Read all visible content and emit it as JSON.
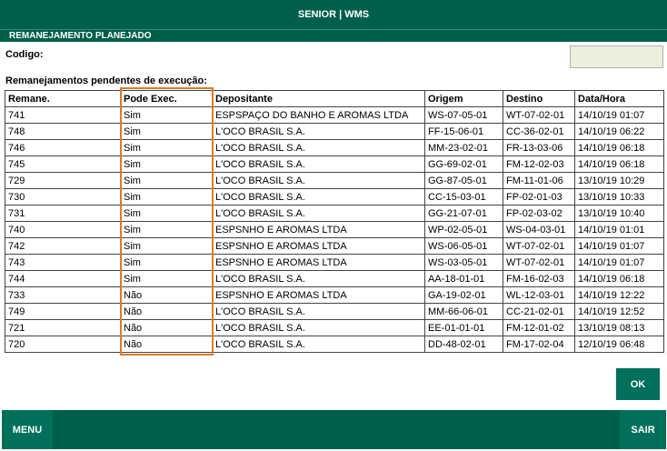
{
  "header": {
    "title": "SENIOR | WMS",
    "subtitle": "REMANEJAMENTO PLANEJADO"
  },
  "form": {
    "code_label": "Codigo:",
    "code_value": ""
  },
  "section_label": "Remanejamentos pendentes de execução:",
  "table": {
    "columns": [
      "Remane.",
      "Pode Exec.",
      "Depositante",
      "Origem",
      "Destino",
      "Data/Hora"
    ],
    "rows": [
      [
        "741",
        "Sim",
        "ESPSPAÇO DO BANHO E AROMAS LTDA",
        "WS-07-05-01",
        "WT-07-02-01",
        "14/10/19 01:07"
      ],
      [
        "748",
        "Sim",
        "L'OCO BRASIL S.A.",
        "FF-15-06-01",
        "CC-36-02-01",
        "14/10/19 06:22"
      ],
      [
        "746",
        "Sim",
        "L'OCO BRASIL S.A.",
        "MM-23-02-01",
        "FR-13-03-06",
        "14/10/19 06:18"
      ],
      [
        "745",
        "Sim",
        "L'OCO BRASIL S.A.",
        "GG-69-02-01",
        "FM-12-02-03",
        "14/10/19 06:18"
      ],
      [
        "729",
        "Sim",
        "L'OCO BRASIL S.A.",
        "GG-87-05-01",
        "FM-11-01-06",
        "13/10/19 10:29"
      ],
      [
        "730",
        "Sim",
        "L'OCO BRASIL S.A.",
        "CC-15-03-01",
        "FP-02-01-03",
        "13/10/19 10:33"
      ],
      [
        "731",
        "Sim",
        "L'OCO BRASIL S.A.",
        "GG-21-07-01",
        "FP-02-03-02",
        "13/10/19 10:40"
      ],
      [
        "740",
        "Sim",
        "ESPSNHO E AROMAS LTDA",
        "WP-02-05-01",
        "WS-04-03-01",
        "14/10/19 01:01"
      ],
      [
        "742",
        "Sim",
        "ESPSNHO E AROMAS LTDA",
        "WS-06-05-01",
        "WT-07-02-01",
        "14/10/19 01:07"
      ],
      [
        "743",
        "Sim",
        "ESPSNHO E AROMAS LTDA",
        "WS-03-05-01",
        "WT-07-02-01",
        "14/10/19 01:07"
      ],
      [
        "744",
        "Sim",
        "L'OCO BRASIL S.A.",
        "AA-18-01-01",
        "FM-16-02-03",
        "14/10/19 06:18"
      ],
      [
        "733",
        "Não",
        "ESPSNHO E AROMAS LTDA",
        "GA-19-02-01",
        "WL-12-03-01",
        "14/10/19 12:22"
      ],
      [
        "749",
        "Não",
        "L'OCO BRASIL S.A.",
        "MM-66-06-01",
        "CC-21-02-01",
        "14/10/19 12:52"
      ],
      [
        "721",
        "Não",
        "L'OCO BRASIL S.A.",
        "EE-01-01-01",
        "FM-12-01-02",
        "13/10/19 08:13"
      ],
      [
        "720",
        "Não",
        "L'OCO BRASIL S.A.",
        "DD-48-02-01",
        "FM-17-02-04",
        "12/10/19 06:48"
      ]
    ]
  },
  "buttons": {
    "ok": "OK",
    "menu": "MENU",
    "exit": "SAIR"
  },
  "colors": {
    "primary": "#005f4b",
    "button": "#00705a",
    "highlight": "#e07b22",
    "input_bg": "#eeeedd"
  }
}
